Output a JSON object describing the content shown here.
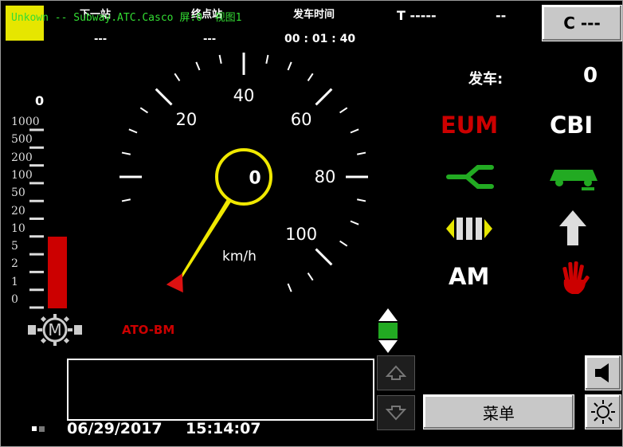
{
  "header": {
    "next_station_label": "下一站",
    "terminal_label": "终点站",
    "departure_time_label": "发车时间",
    "next_station_value": "---",
    "terminal_value": "---",
    "departure_time_value": "00 : 01 : 40",
    "train_label": "T -----",
    "train_value": "--"
  },
  "overlay_text": "Unkown -- Subway.ATC.Casco 屏:0  视图1",
  "c_button_label": "C ---",
  "departure_count_label": "发车:",
  "departure_count_value": "0",
  "speedometer": {
    "current_speed": "0",
    "unit": "km/h",
    "labels": [
      "20",
      "40",
      "60",
      "80",
      "100"
    ],
    "needle_speed": 0,
    "target_marker_speed": 0
  },
  "mode_label": "ATO-BM",
  "indicators": {
    "eum": "EUM",
    "cbi": "CBI",
    "am": "AM",
    "eum_color": "#cc0000",
    "switch_color": "#22aa22",
    "train_color": "#22aa22",
    "stop_hand_color": "#cc0000"
  },
  "traction_scale": {
    "top_value": "0",
    "labels": [
      "1000",
      "500",
      "200",
      "100",
      "50",
      "20",
      "10",
      "5",
      "2",
      "1",
      "0"
    ],
    "level_label_index": 7
  },
  "footer": {
    "date": "06/29/2017",
    "time": "15:14:07",
    "menu_label": "菜单"
  }
}
